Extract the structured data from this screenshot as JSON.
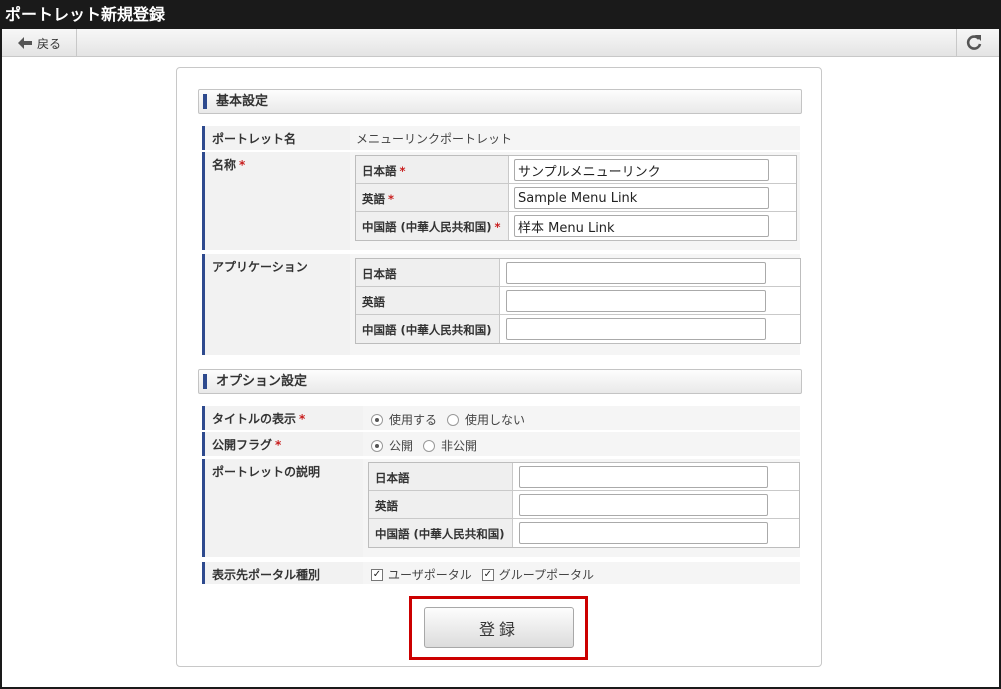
{
  "window": {
    "title": "ポートレット新規登録"
  },
  "toolbar": {
    "back_label": "戻る"
  },
  "sections": {
    "basic": "基本設定",
    "options": "オプション設定"
  },
  "portlet_name": {
    "label": "ポートレット名",
    "value": "メニューリンクポートレット"
  },
  "name": {
    "label": "名称",
    "required_mark": "*",
    "rows": [
      {
        "label": "日本語",
        "value": "サンプルメニューリンク"
      },
      {
        "label": "英語",
        "value": "Sample Menu Link"
      },
      {
        "label": "中国語 (中華人民共和国)",
        "value": "样本 Menu Link"
      }
    ]
  },
  "application": {
    "label": "アプリケーション",
    "rows": [
      {
        "label": "日本語",
        "value": ""
      },
      {
        "label": "英語",
        "value": ""
      },
      {
        "label": "中国語 (中華人民共和国)",
        "value": ""
      }
    ]
  },
  "title_display": {
    "label": "タイトルの表示",
    "options": [
      "使用する",
      "使用しない"
    ],
    "selected": "使用する"
  },
  "public_flag": {
    "label": "公開フラグ",
    "options": [
      "公開",
      "非公開"
    ],
    "selected": "公開"
  },
  "description": {
    "label": "ポートレットの説明",
    "rows": [
      {
        "label": "日本語",
        "value": ""
      },
      {
        "label": "英語",
        "value": ""
      },
      {
        "label": "中国語 (中華人民共和国)",
        "value": ""
      }
    ]
  },
  "portal_type": {
    "label": "表示先ポータル種別",
    "options": [
      "ユーザポータル",
      "グループポータル"
    ],
    "checked": [
      true,
      true
    ]
  },
  "submit": {
    "label": "登録"
  },
  "colors": {
    "accent": "#2e4a8e",
    "required": "#c81d1d",
    "highlight": "#cc0000",
    "titlebar": "#1a1a1a"
  }
}
